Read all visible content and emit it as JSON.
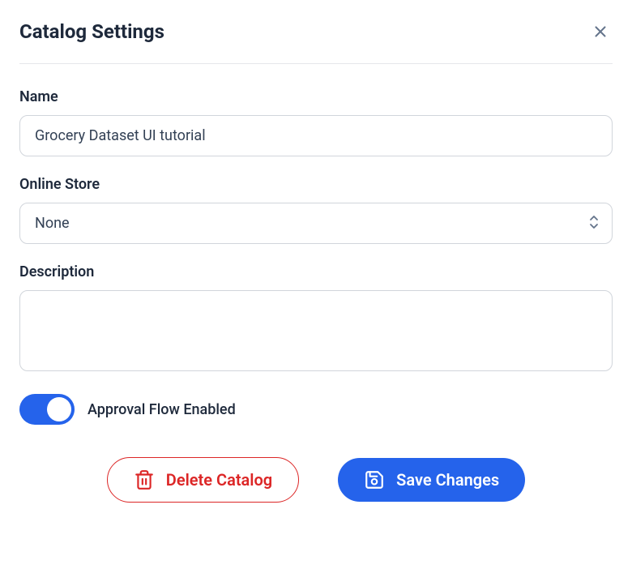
{
  "header": {
    "title": "Catalog Settings"
  },
  "form": {
    "name": {
      "label": "Name",
      "value": "Grocery Dataset UI tutorial"
    },
    "onlineStore": {
      "label": "Online Store",
      "value": "None"
    },
    "description": {
      "label": "Description",
      "value": ""
    },
    "approvalFlow": {
      "label": "Approval Flow Enabled",
      "enabled": true
    }
  },
  "buttons": {
    "delete": "Delete Catalog",
    "save": "Save Changes"
  }
}
